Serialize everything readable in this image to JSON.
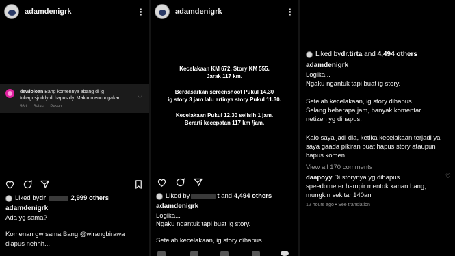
{
  "panel1": {
    "username": "adamdenigrk",
    "notification": {
      "username": "dewioloan",
      "text": "Bang komennya abang di ig tubagusjoddy di hapus dy. Makin mencurigakan",
      "time": "56d",
      "reply": "Balas",
      "message": "Pesan"
    },
    "liked": {
      "prefix": "Liked by ",
      "name": "dr",
      "count": "2,999 others"
    },
    "caption_user": "adamdenigrk",
    "lines": [
      "Ada yg sama?",
      "Komenan gw sama Bang @wirangbirawa",
      "diapus nehhh..."
    ]
  },
  "panel2": {
    "username": "adamdenigrk",
    "story": [
      "Kecelakaan KM 672, Story KM 555.",
      "Jarak 117 km.",
      "Berdasarkan screenshoot Pukul 14.30",
      "ig story 3 jam lalu artinya story Pukul 11.30.",
      "Kecelakaan Pukul 12.30 selisih 1 jam.",
      "Berarti kecepatan 117 km /jam."
    ],
    "liked": {
      "prefix": "Liked by ",
      "name": "t",
      "count": "4,494 others"
    },
    "caption_user": "adamdenigrk",
    "lines": [
      "Logika...",
      "Ngaku ngantuk tapi buat ig story.",
      "Setelah kecelakaan, ig story dihapus."
    ]
  },
  "panel3": {
    "liked": {
      "prefix": "Liked by ",
      "name": "dr.tirta",
      "count": "4,494 others"
    },
    "caption_user": "adamdenigrk",
    "lines": [
      "Logika...",
      "Ngaku ngantuk tapi buat ig story.",
      "Setelah kecelakaan, ig story dihapus.",
      "Selang beberapa jam, banyak komentar",
      "netizen yg dihapus.",
      "Kalo saya jadi dia, ketika kecelakaan terjadi ya",
      "saya gaada pikiran buat hapus story ataupun",
      "hapus komen."
    ],
    "view_all": "View all 170 comments",
    "comment": {
      "username": "daapoyy",
      "lines": [
        "Di storynya yg dihapus",
        "speedometer hampir mentok kanan bang,",
        "mungkin sekitar 140an"
      ]
    },
    "meta": "12 hours ago • See translation"
  },
  "icons": {
    "heart": "heart-icon",
    "comment": "comment-icon",
    "share": "share-icon",
    "save": "bookmark-icon",
    "more": "more-icon"
  }
}
